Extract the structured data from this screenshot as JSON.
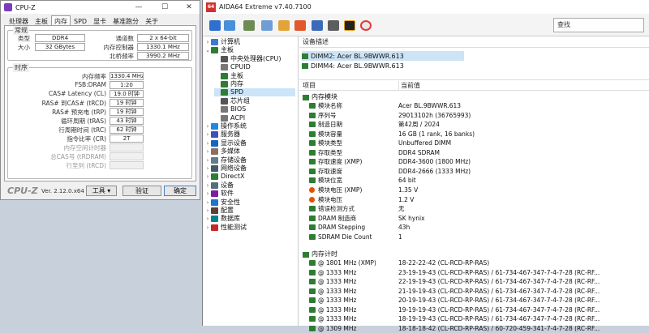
{
  "cpuz": {
    "title": "CPU-Z",
    "window_buttons": {
      "min": "—",
      "max": "☐",
      "close": "✕"
    },
    "tabs": [
      "处理器",
      "主板",
      "内存",
      "SPD",
      "显卡",
      "基准跑分",
      "关于"
    ],
    "general": {
      "label": "常规",
      "type_label": "类型",
      "type_value": "DDR4",
      "channels_label": "通道数",
      "channels_value": "2 x 64-bit",
      "size_label": "大小",
      "size_value": "32 GBytes",
      "mc_label": "内存控制器",
      "mc_value": "1330.1 MHz",
      "nb_label": "北桥频率",
      "nb_value": "3990.2 MHz"
    },
    "timings": {
      "label": "时序",
      "rows": [
        {
          "label": "内存频率",
          "value": "1330.4 MHz",
          "dis": false
        },
        {
          "label": "FSB:DRAM",
          "value": "1:20",
          "dis": false
        },
        {
          "label": "CAS# Latency (CL)",
          "value": "19.0 时钟",
          "dis": false
        },
        {
          "label": "RAS# 到CAS# (tRCD)",
          "value": "19 时钟",
          "dis": false
        },
        {
          "label": "RAS# 预充电 (tRP)",
          "value": "19 时钟",
          "dis": false
        },
        {
          "label": "循环周期 (tRAS)",
          "value": "43 时钟",
          "dis": false
        },
        {
          "label": "行周期时间 (tRC)",
          "value": "62 时钟",
          "dis": false
        },
        {
          "label": "指令比率 (CR)",
          "value": "2T",
          "dis": false
        },
        {
          "label": "内存空闲计时器",
          "value": "",
          "dis": true
        },
        {
          "label": "总CAS号 (tRDRAM)",
          "value": "",
          "dis": true
        },
        {
          "label": "行至列 (tRCD)",
          "value": "",
          "dis": true
        }
      ]
    },
    "footer": {
      "brand": "CPU-Z",
      "version": "Ver. 2.12.0.x64",
      "tools": "工具",
      "validate": "验证",
      "ok": "确定"
    }
  },
  "aida": {
    "title": "AIDA64 Extreme v7.40.7100",
    "logo": "64",
    "search_placeholder": "查找",
    "tree": [
      {
        "label": "计算机",
        "tw": "›",
        "color": "#3b7bd4"
      },
      {
        "label": "主板",
        "tw": "⌄",
        "color": "#2e7d32"
      },
      {
        "label": "中央处理器(CPU)",
        "tw": "",
        "color": "#555"
      },
      {
        "label": "CPUID",
        "tw": "",
        "color": "#777"
      },
      {
        "label": "主板",
        "tw": "",
        "color": "#2e7d32"
      },
      {
        "label": "内存",
        "tw": "",
        "color": "#2e7d32"
      },
      {
        "label": "SPD",
        "tw": "",
        "color": "#2e7d32"
      },
      {
        "label": "芯片组",
        "tw": "",
        "color": "#555"
      },
      {
        "label": "BIOS",
        "tw": "",
        "color": "#777"
      },
      {
        "label": "ACPI",
        "tw": "",
        "color": "#777"
      },
      {
        "label": "操作系统",
        "tw": "›",
        "color": "#1e88e5"
      },
      {
        "label": "服务器",
        "tw": "›",
        "color": "#3f51b5"
      },
      {
        "label": "显示设备",
        "tw": "›",
        "color": "#1565c0"
      },
      {
        "label": "多媒体",
        "tw": "›",
        "color": "#8d6e63"
      },
      {
        "label": "存储设备",
        "tw": "›",
        "color": "#607d8b"
      },
      {
        "label": "网络设备",
        "tw": "›",
        "color": "#455a64"
      },
      {
        "label": "DirectX",
        "tw": "›",
        "color": "#2e7d32"
      },
      {
        "label": "设备",
        "tw": "›",
        "color": "#546e7a"
      },
      {
        "label": "软件",
        "tw": "›",
        "color": "#7b1fa2"
      },
      {
        "label": "安全性",
        "tw": "›",
        "color": "#1976d2"
      },
      {
        "label": "配置",
        "tw": "›",
        "color": "#5d4037"
      },
      {
        "label": "数据库",
        "tw": "›",
        "color": "#00838f"
      },
      {
        "label": "性能测试",
        "tw": "›",
        "color": "#c62828"
      }
    ],
    "device_desc_header": "设备描述",
    "dimms": [
      "DIMM2: Acer BL.9BWWR.613",
      "DIMM4: Acer BL.9BWWR.613"
    ],
    "col_item": "项目",
    "col_value": "当前值",
    "module_section": "内存模块",
    "module_rows": [
      {
        "k": "模块名称",
        "v": "Acer BL.9BWWR.613"
      },
      {
        "k": "序列号",
        "v": "29013102h (36765993)"
      },
      {
        "k": "制造日期",
        "v": "第42周 / 2024"
      },
      {
        "k": "模块容量",
        "v": "16 GB (1 rank, 16 banks)"
      },
      {
        "k": "模块类型",
        "v": "Unbuffered DIMM"
      },
      {
        "k": "存取类型",
        "v": "DDR4 SDRAM"
      },
      {
        "k": "存取速度 (XMP)",
        "v": "DDR4-3600 (1800 MHz)"
      },
      {
        "k": "存取速度",
        "v": "DDR4-2666 (1333 MHz)"
      },
      {
        "k": "模块位宽",
        "v": "64 bit"
      },
      {
        "k": "模块电压 (XMP)",
        "v": "1.35 V"
      },
      {
        "k": "模块电压",
        "v": "1.2 V"
      },
      {
        "k": "错误检测方式",
        "v": "无"
      },
      {
        "k": "DRAM 制造商",
        "v": "SK hynix"
      },
      {
        "k": "DRAM Stepping",
        "v": "43h"
      },
      {
        "k": "SDRAM Die Count",
        "v": "1"
      }
    ],
    "timing_section": "内存计时",
    "timing_rows": [
      {
        "k": "@ 1801 MHz (XMP)",
        "v": "18-22-22-42  (CL-RCD-RP-RAS)"
      },
      {
        "k": "@ 1333 MHz",
        "v": "23-19-19-43  (CL-RCD-RP-RAS) / 61-734-467-347-7-4-7-28  (RC-RF..."
      },
      {
        "k": "@ 1333 MHz",
        "v": "22-19-19-43  (CL-RCD-RP-RAS) / 61-734-467-347-7-4-7-28  (RC-RF..."
      },
      {
        "k": "@ 1333 MHz",
        "v": "21-19-19-43  (CL-RCD-RP-RAS) / 61-734-467-347-7-4-7-28  (RC-RF..."
      },
      {
        "k": "@ 1333 MHz",
        "v": "20-19-19-43  (CL-RCD-RP-RAS) / 61-734-467-347-7-4-7-28  (RC-RF..."
      },
      {
        "k": "@ 1333 MHz",
        "v": "19-19-19-43  (CL-RCD-RP-RAS) / 61-734-467-347-7-4-7-28  (RC-RF..."
      },
      {
        "k": "@ 1333 MHz",
        "v": "18-19-19-43  (CL-RCD-RP-RAS) / 61-734-467-347-7-4-7-28  (RC-RF..."
      },
      {
        "k": "@ 1309 MHz",
        "v": "18-18-18-42  (CL-RCD-RP-RAS) / 60-720-459-341-7-4-7-28  (RC-RF..."
      }
    ]
  }
}
